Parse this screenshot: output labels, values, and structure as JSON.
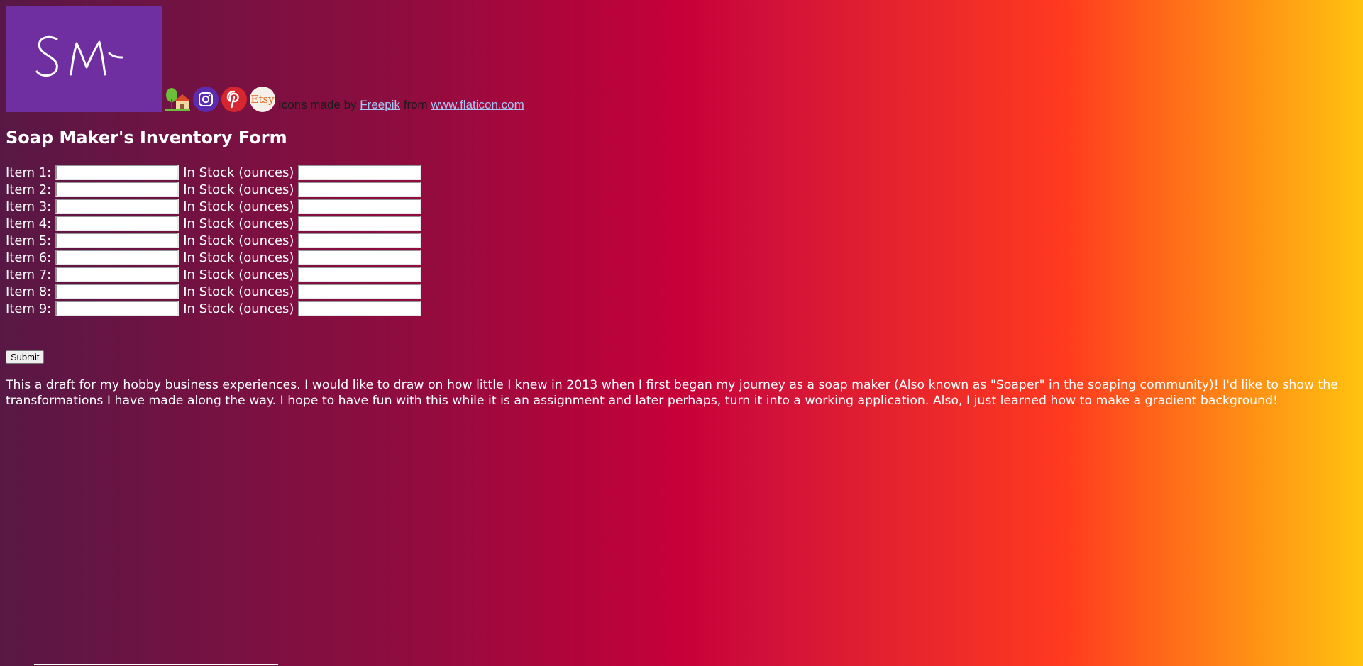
{
  "header": {
    "logo_text": "SM",
    "credit": {
      "prefix": "Icons made by",
      "author_link": "Freepik",
      "middle": "from",
      "site_link": "www.flaticon.com"
    },
    "social_icons": [
      "home-icon",
      "instagram-icon",
      "pinterest-icon",
      "etsy-icon"
    ],
    "etsy_label": "Etsy"
  },
  "form": {
    "title": "Soap Maker's Inventory Form",
    "stock_label": "In Stock (ounces)",
    "items": [
      {
        "label": "Item 1:",
        "name_value": "",
        "stock_value": ""
      },
      {
        "label": "Item 2:",
        "name_value": "",
        "stock_value": ""
      },
      {
        "label": "Item 3:",
        "name_value": "",
        "stock_value": ""
      },
      {
        "label": "Item 4:",
        "name_value": "",
        "stock_value": ""
      },
      {
        "label": "Item 5:",
        "name_value": "",
        "stock_value": ""
      },
      {
        "label": "Item 6:",
        "name_value": "",
        "stock_value": ""
      },
      {
        "label": "Item 7:",
        "name_value": "",
        "stock_value": ""
      },
      {
        "label": "Item 8:",
        "name_value": "",
        "stock_value": ""
      },
      {
        "label": "Item 9:",
        "name_value": "",
        "stock_value": ""
      }
    ],
    "submit_label": "Submit"
  },
  "description": "This a draft for my hobby business experiences. I would like to draw on how little I knew in 2013 when I first began my journey as a soap maker (Also known as \"Soaper\" in the soaping community)! I'd like to show the transformations I have made along the way. I hope to have fun with this while it is an assignment and later perhaps, turn it into a working application. Also, I just learned how to make a gradient background!",
  "colors": {
    "gradient": [
      "#581845",
      "#900c3f",
      "#c70039",
      "#ff3a1f",
      "#ffc30f"
    ],
    "logo_bg": "#6f2fa0"
  }
}
